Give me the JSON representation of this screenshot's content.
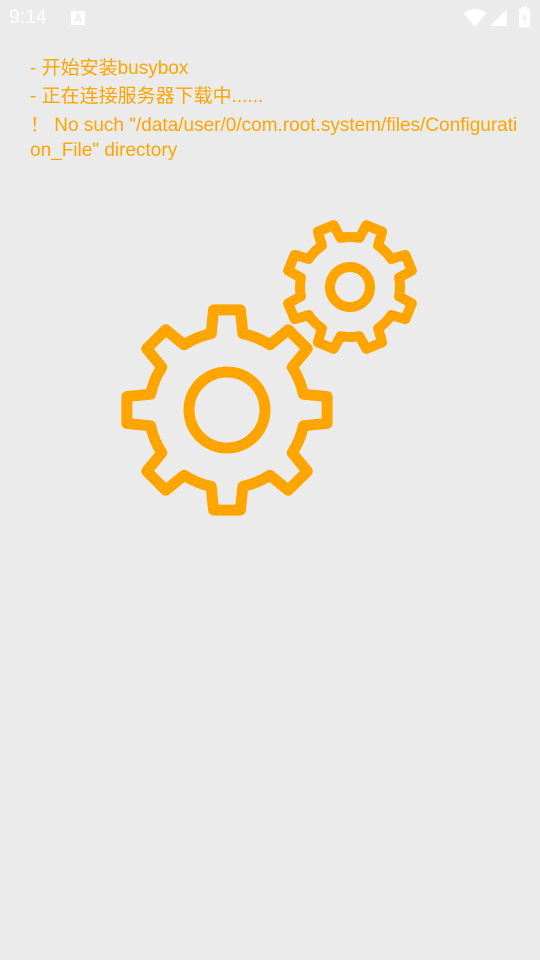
{
  "status_bar": {
    "time": "9:14",
    "icons": [
      "notification-a-icon",
      "wifi-icon",
      "signal-icon",
      "battery-icon"
    ],
    "icon_color": "#ffffff"
  },
  "log": {
    "lines": [
      "- 开始安装busybox",
      "- 正在连接服务器下载中......",
      "！ No such \"/data/user/0/com.root.system/files/Configuration_File\" directory"
    ],
    "text_color": "#ffa500"
  },
  "illustration": {
    "icon": "gears-icon",
    "color": "#ffa500"
  },
  "background_color": "#ebebeb"
}
